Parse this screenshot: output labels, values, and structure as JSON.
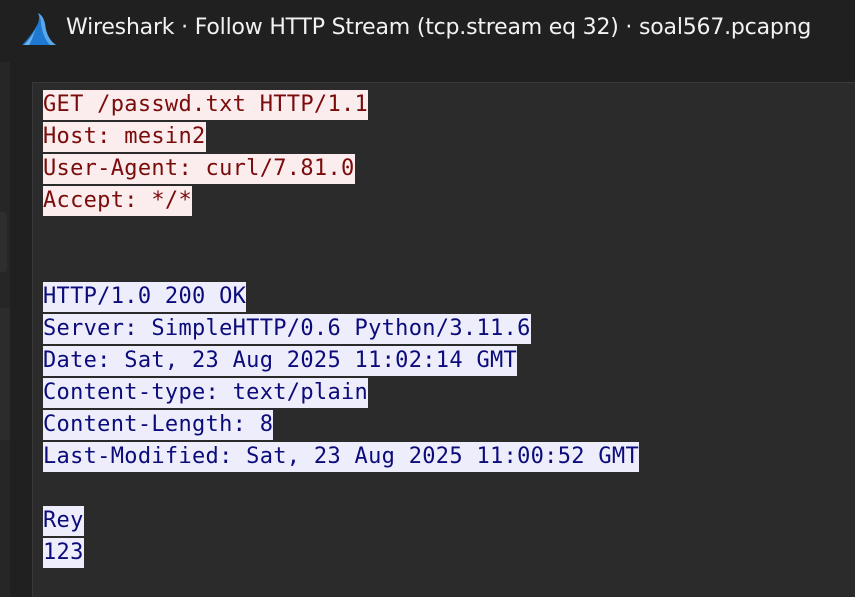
{
  "window": {
    "title": "Wireshark · Follow HTTP Stream (tcp.stream eq 32) · soal567.pcapng",
    "app_icon": "wireshark-fin-icon"
  },
  "colors": {
    "client_bg": "#fbeded",
    "client_fg": "#7a0b0b",
    "server_bg": "#ededfb",
    "server_fg": "#0b0b7a",
    "pane_bg": "#2b2b2b",
    "titlebar_bg": "#202020",
    "icon_blue": "#1f78d1"
  },
  "stream": {
    "client_request": [
      "GET /passwd.txt HTTP/1.1",
      "Host: mesin2",
      "User-Agent: curl/7.81.0",
      "Accept: */*"
    ],
    "server_response_headers": [
      "HTTP/1.0 200 OK",
      "Server: SimpleHTTP/0.6 Python/3.11.6",
      "Date: Sat, 23 Aug 2025 11:02:14 GMT",
      "Content-type: text/plain",
      "Content-Length: 8",
      "Last-Modified: Sat, 23 Aug 2025 11:00:52 GMT"
    ],
    "server_response_body": [
      "Rey",
      "123"
    ]
  }
}
